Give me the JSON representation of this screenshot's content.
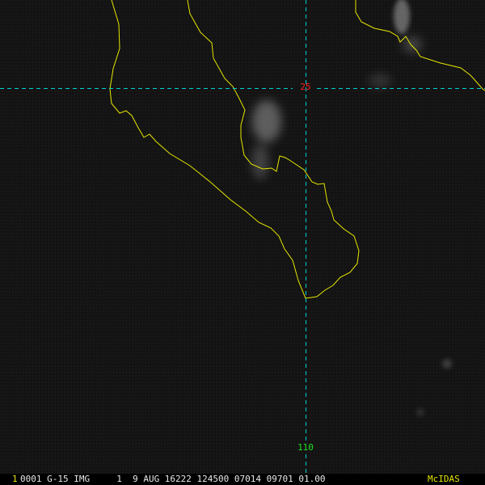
{
  "grid": {
    "latitude_label": "25",
    "longitude_label": "110"
  },
  "status_bar": {
    "frame": "1",
    "info": "0001 G-15 IMG     1  9 AUG 16222 124500 07014 09701 01.00",
    "brand": "McIDAS"
  },
  "colors": {
    "background": "#141414",
    "coastline": "#e6e600",
    "gridline": "#00d0d0",
    "latitude_label": "#ff2020",
    "longitude_label": "#20e020",
    "frame_number": "#e6e600",
    "status_text": "#e8e8e8",
    "brand": "#e6e600",
    "cloud": "#9a9a9a"
  }
}
